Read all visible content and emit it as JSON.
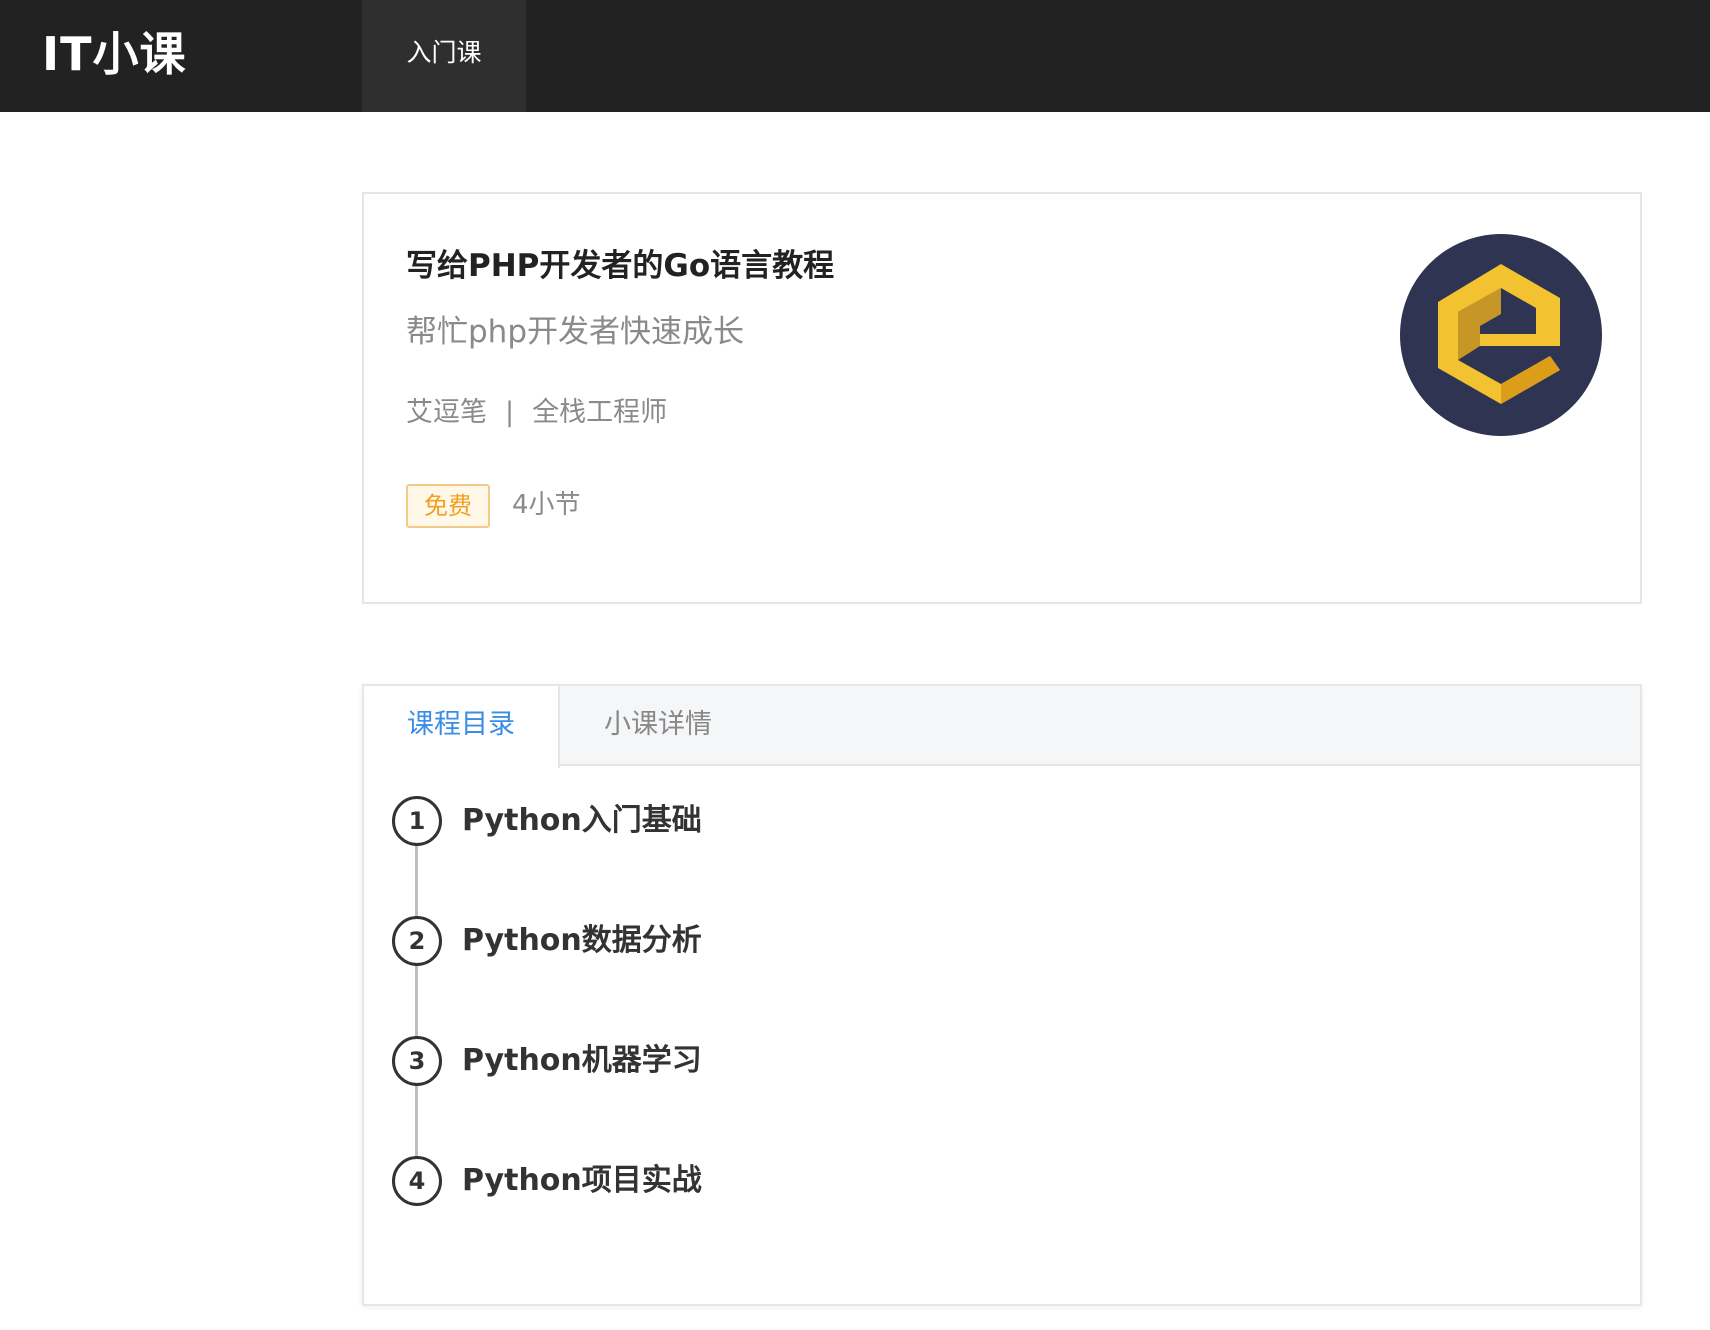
{
  "header": {
    "brand": "IT小课",
    "nav_tab": "入门课"
  },
  "course": {
    "title": "写给PHP开发者的Go语言教程",
    "subtitle": "帮忙php开发者快速成长",
    "author": "艾逗笔",
    "separator": "|",
    "role": "全栈工程师",
    "price_badge": "免费",
    "lessons": "4小节",
    "logo_icon": "course-logo-icon"
  },
  "tabs": [
    {
      "label": "课程目录",
      "active": true
    },
    {
      "label": "小课详情",
      "active": false
    }
  ],
  "chapters": [
    {
      "num": "1",
      "title": "Python入门基础"
    },
    {
      "num": "2",
      "title": "Python数据分析"
    },
    {
      "num": "3",
      "title": "Python机器学习"
    },
    {
      "num": "4",
      "title": "Python项目实战"
    }
  ],
  "colors": {
    "topbar": "#222222",
    "accent_tab": "#3a8ee6",
    "badge_text": "#f0a020",
    "badge_border": "#f4c98a",
    "logo_bg": "#2e3452",
    "logo_gold": "#f2c230"
  }
}
